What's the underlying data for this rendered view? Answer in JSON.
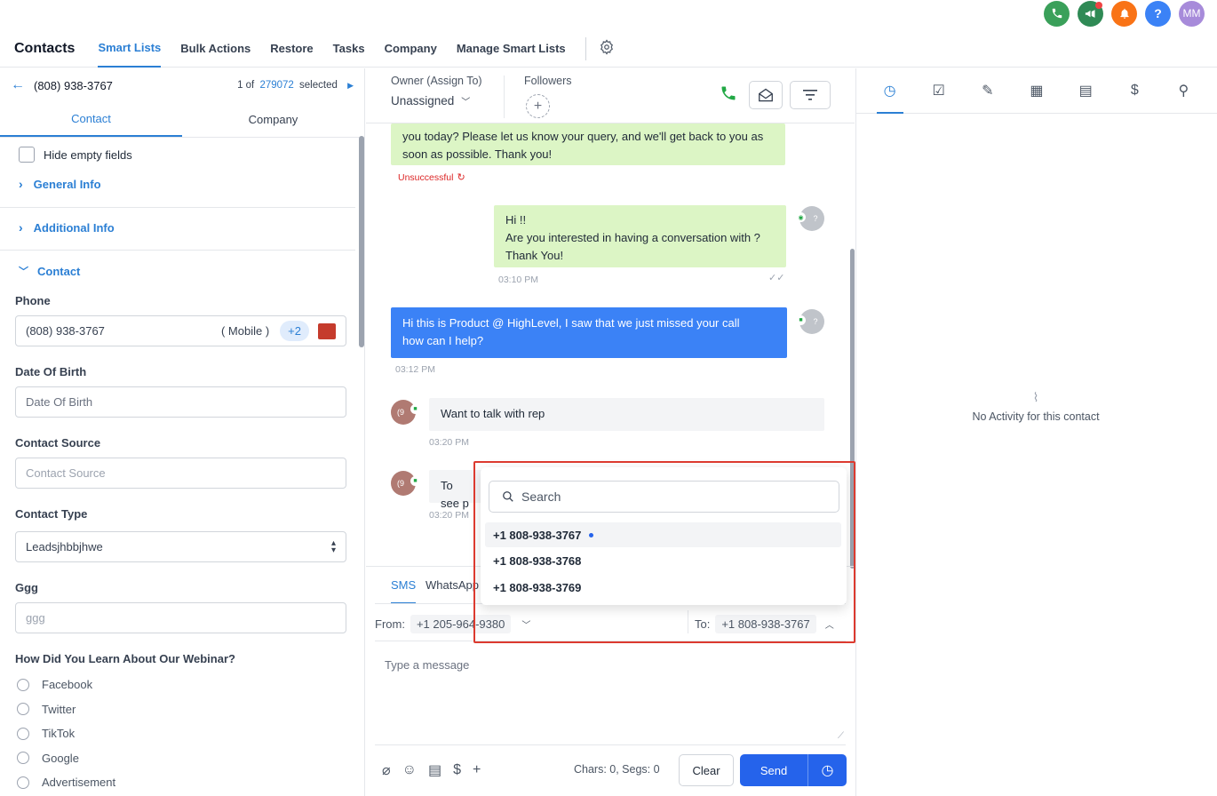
{
  "header": {
    "icons": [
      {
        "name": "phone-icon",
        "color": "#3aa05a"
      },
      {
        "name": "megaphone-icon",
        "color": "#2f8a55"
      },
      {
        "name": "bell-icon",
        "color": "#f97316"
      },
      {
        "name": "help-icon",
        "color": "#3b82f6",
        "glyph": "?"
      },
      {
        "name": "avatar",
        "color": "#a78bda",
        "glyph": "MM"
      }
    ]
  },
  "nav": {
    "brand": "Contacts",
    "items": [
      "Smart Lists",
      "Bulk Actions",
      "Restore",
      "Tasks",
      "Company",
      "Manage Smart Lists"
    ]
  },
  "left": {
    "phone_title": "(808) 938-3767",
    "pager_of": "1 of",
    "pager_count": "279072",
    "pager_selected": "selected",
    "tab_contact": "Contact",
    "tab_company": "Company",
    "hide_empty": "Hide empty fields",
    "sec_general": "General Info",
    "sec_additional": "Additional Info",
    "sec_contact": "Contact",
    "phone_label": "Phone",
    "phone_value": "(808) 938-3767",
    "phone_type": "( Mobile )",
    "phone_more": "+2",
    "dob_label": "Date Of Birth",
    "dob_placeholder": "Date Of Birth",
    "source_label": "Contact Source",
    "source_placeholder": "Contact Source",
    "type_label": "Contact Type",
    "type_value": "Leadsjhbbjhwe",
    "ggg_label": "Ggg",
    "ggg_placeholder": "ggg",
    "webinar_label": "How Did You Learn About Our Webinar?",
    "webinar_options": [
      "Facebook",
      "Twitter",
      "TikTok",
      "Google",
      "Advertisement"
    ]
  },
  "mid": {
    "owner_label": "Owner (Assign To)",
    "owner_value": "Unassigned",
    "followers_label": "Followers",
    "msg1_line1": "you today? Please let us know your query, and we'll get back to you as",
    "msg1_line2": "soon as possible. Thank you!",
    "msg1_status": "Unsuccessful",
    "msg2_line1": "Hi !!",
    "msg2_line2": "Are you interested in having a conversation with ?",
    "msg2_line3": "Thank You!",
    "msg2_time": "03:10 PM",
    "msg3_line1": "Hi this is Product @ HighLevel, I saw that we just missed your call",
    "msg3_line2": "how can I help?",
    "msg3_time": "03:12 PM",
    "msg4_text": "Want to talk with rep",
    "msg4_time": "03:20 PM",
    "msg5_text": "To see p",
    "msg5_time": "03:20 PM",
    "avatar_text": "(9",
    "avatar_q": "?",
    "channel_sms": "SMS",
    "channel_whatsapp": "WhatsApp",
    "from_label": "From:",
    "from_value": "+1 205-964-9380",
    "to_label": "To:",
    "to_value": "+1 808-938-3767",
    "compose_placeholder": "Type a message",
    "chars": "Chars: 0, Segs: 0",
    "clear": "Clear",
    "send": "Send"
  },
  "dropdown": {
    "search_placeholder": "Search",
    "options": [
      "+1 808-938-3767",
      "+1 808-938-3768",
      "+1 808-938-3769"
    ]
  },
  "right": {
    "empty_text": "No Activity for this contact"
  },
  "colors": {
    "accent": "#2b7fd4",
    "send": "#2563eb",
    "highlight": "#dc3a2f"
  }
}
